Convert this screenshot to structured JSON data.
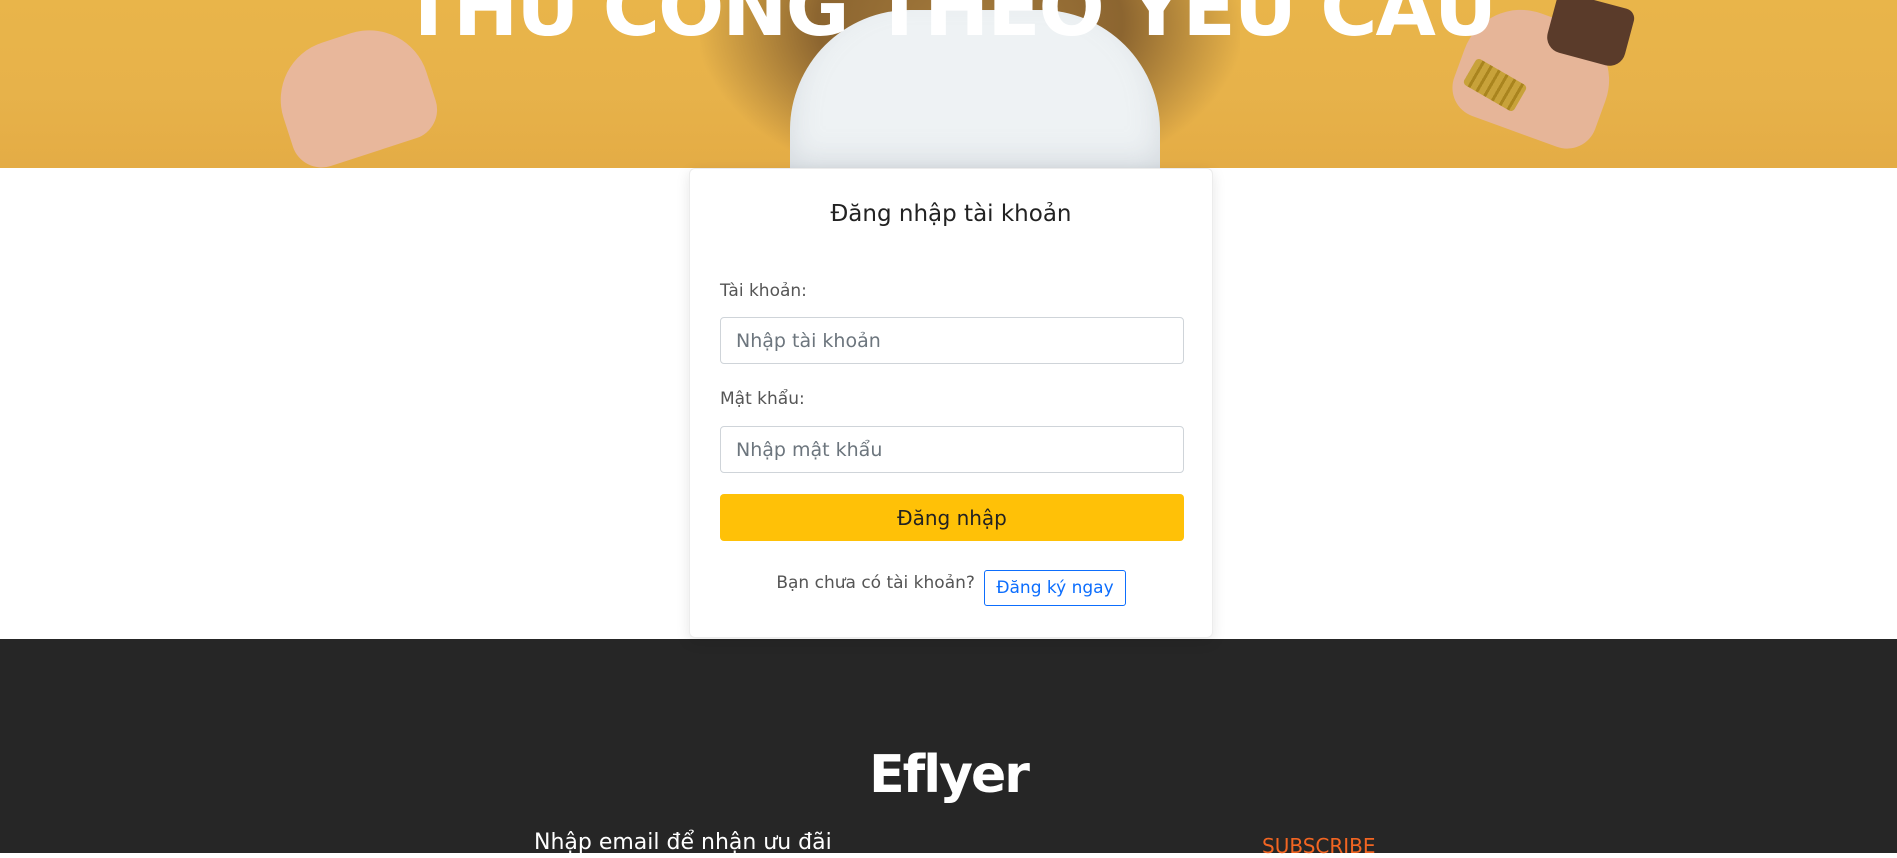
{
  "hero": {
    "title": "THỦ CÔNG THEO YÊU CẦU"
  },
  "login": {
    "title": "Đăng nhập tài khoản",
    "username_label": "Tài khoản:",
    "username_placeholder": "Nhập tài khoản",
    "password_label": "Mật khẩu:",
    "password_placeholder": "Nhập mật khẩu",
    "submit_label": "Đăng nhập",
    "signup_prompt": "Bạn chưa có tài khoản?",
    "signup_link": "Đăng ký ngay"
  },
  "footer": {
    "logo": "Eflyer",
    "email_label": "Nhập email để nhận ưu đãi",
    "subscribe_label": "SUBSCRIBE"
  },
  "colors": {
    "hero_bg": "#e7b24a",
    "button_accent": "#ffc107",
    "link_blue": "#0d6efd",
    "footer_bg": "#262626",
    "subscribe_orange": "#f26522"
  },
  "icons": {
    "hero_image": "woman-dancing-photo"
  }
}
